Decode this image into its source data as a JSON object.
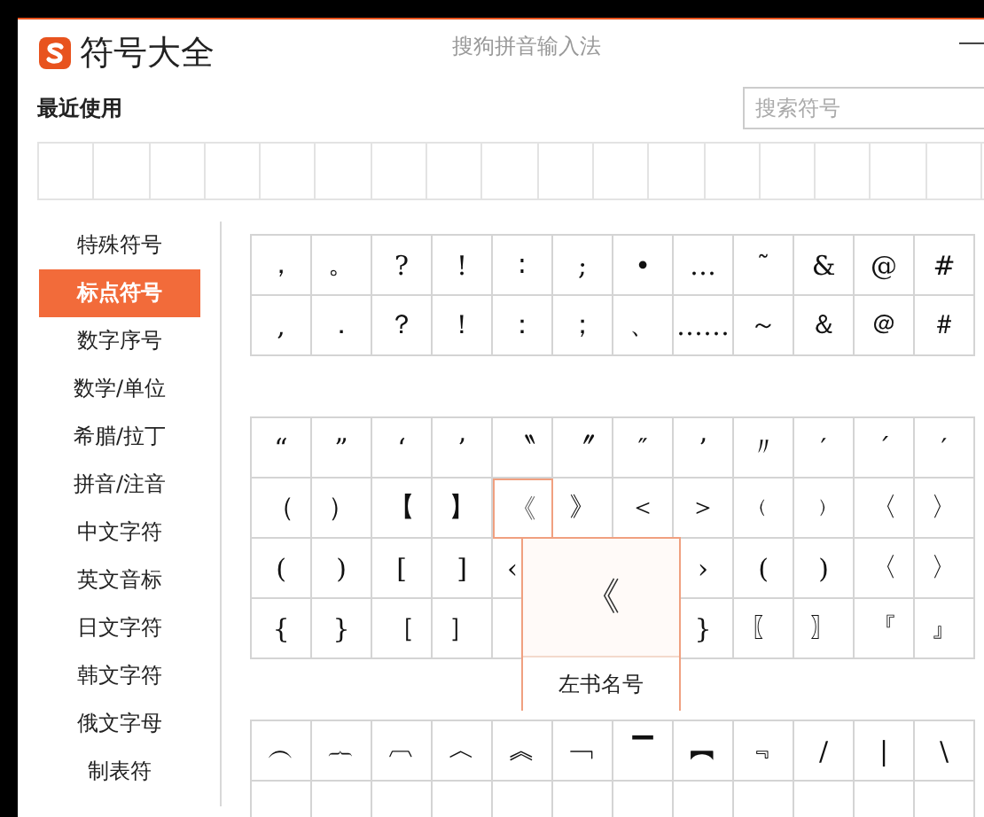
{
  "window": {
    "title": "符号大全",
    "app_name": "搜狗拼音输入法",
    "minimize": "—"
  },
  "recent": {
    "label": "最近使用"
  },
  "search": {
    "placeholder": "搜索符号"
  },
  "sidebar": {
    "items": [
      {
        "label": "特殊符号",
        "selected": false
      },
      {
        "label": "标点符号",
        "selected": true
      },
      {
        "label": "数字序号",
        "selected": false
      },
      {
        "label": "数学/单位",
        "selected": false
      },
      {
        "label": "希腊/拉丁",
        "selected": false
      },
      {
        "label": "拼音/注音",
        "selected": false
      },
      {
        "label": "中文字符",
        "selected": false
      },
      {
        "label": "英文音标",
        "selected": false
      },
      {
        "label": "日文字符",
        "selected": false
      },
      {
        "label": "韩文字符",
        "selected": false
      },
      {
        "label": "俄文字母",
        "selected": false
      },
      {
        "label": "制表符",
        "selected": false
      }
    ]
  },
  "symbol_groups": [
    {
      "rows": [
        [
          {
            "symbol": "，",
            "hovered": false
          },
          {
            "symbol": "。",
            "hovered": false
          },
          {
            "symbol": "?",
            "hovered": false
          },
          {
            "symbol": "!",
            "hovered": false
          },
          {
            "symbol": "∶",
            "hovered": false
          },
          {
            "symbol": ";",
            "hovered": false
          },
          {
            "symbol": "•",
            "hovered": false
          },
          {
            "symbol": "…",
            "hovered": false
          },
          {
            "symbol": "˜",
            "hovered": false
          },
          {
            "symbol": "&",
            "hovered": false
          },
          {
            "symbol": "@",
            "hovered": false
          },
          {
            "symbol": "#",
            "hovered": false
          }
        ],
        [
          {
            "symbol": ",",
            "hovered": false
          },
          {
            "symbol": "．",
            "hovered": false
          },
          {
            "symbol": "？",
            "hovered": false
          },
          {
            "symbol": "！",
            "hovered": false
          },
          {
            "symbol": "：",
            "hovered": false
          },
          {
            "symbol": "；",
            "hovered": false
          },
          {
            "symbol": "、",
            "hovered": false
          },
          {
            "symbol": "……",
            "hovered": false
          },
          {
            "symbol": "～",
            "hovered": false
          },
          {
            "symbol": "＆",
            "hovered": false
          },
          {
            "symbol": "＠",
            "hovered": false
          },
          {
            "symbol": "＃",
            "hovered": false
          }
        ]
      ]
    },
    {
      "rows": [
        [
          {
            "symbol": "“",
            "hovered": false
          },
          {
            "symbol": "”",
            "hovered": false
          },
          {
            "symbol": "‘",
            "hovered": false
          },
          {
            "symbol": "’",
            "hovered": false
          },
          {
            "symbol": "〝",
            "hovered": false
          },
          {
            "symbol": "〞",
            "hovered": false
          },
          {
            "symbol": "″",
            "hovered": false
          },
          {
            "symbol": "’",
            "hovered": false
          },
          {
            "symbol": "〃",
            "hovered": false
          },
          {
            "symbol": "′",
            "hovered": false
          },
          {
            "symbol": "´",
            "hovered": false
          },
          {
            "symbol": "′",
            "hovered": false
          }
        ],
        [
          {
            "symbol": "（",
            "hovered": false
          },
          {
            "symbol": "）",
            "hovered": false
          },
          {
            "symbol": "【",
            "hovered": false
          },
          {
            "symbol": "】",
            "hovered": false
          },
          {
            "symbol": "《",
            "hovered": true
          },
          {
            "symbol": "》",
            "hovered": false
          },
          {
            "symbol": "＜",
            "hovered": false
          },
          {
            "symbol": "＞",
            "hovered": false
          },
          {
            "symbol": "﹙",
            "hovered": false
          },
          {
            "symbol": "﹚",
            "hovered": false
          },
          {
            "symbol": "〈",
            "hovered": false
          },
          {
            "symbol": "〉",
            "hovered": false
          }
        ],
        [
          {
            "symbol": "(",
            "hovered": false
          },
          {
            "symbol": ")",
            "hovered": false
          },
          {
            "symbol": "[",
            "hovered": false
          },
          {
            "symbol": "]",
            "hovered": false
          },
          {
            "symbol": "‹",
            "hovered": false
          },
          null,
          null,
          {
            "symbol": "›",
            "hovered": false
          },
          {
            "symbol": "(",
            "hovered": false
          },
          {
            "symbol": ")",
            "hovered": false
          },
          {
            "symbol": "〈",
            "hovered": false
          },
          {
            "symbol": "〉",
            "hovered": false
          }
        ],
        [
          {
            "symbol": "{",
            "hovered": false
          },
          {
            "symbol": "}",
            "hovered": false
          },
          {
            "symbol": "［",
            "hovered": false
          },
          {
            "symbol": "］",
            "hovered": false
          },
          null,
          null,
          null,
          {
            "symbol": "}",
            "hovered": false
          },
          {
            "symbol": "〖",
            "hovered": false
          },
          {
            "symbol": "〗",
            "hovered": false
          },
          {
            "symbol": "『",
            "hovered": false
          },
          {
            "symbol": "』",
            "hovered": false
          }
        ]
      ]
    },
    {
      "rows": [
        [
          {
            "symbol": "︵",
            "hovered": false
          },
          {
            "symbol": "︷",
            "hovered": false
          },
          {
            "symbol": "︹",
            "hovered": false
          },
          {
            "symbol": "︿",
            "hovered": false
          },
          {
            "symbol": "︽",
            "hovered": false
          },
          {
            "symbol": "﹁",
            "hovered": false
          },
          {
            "symbol": "▔",
            "hovered": false
          },
          {
            "symbol": "︻",
            "hovered": false
          },
          {
            "symbol": "﹃",
            "hovered": false
          },
          {
            "symbol": "/",
            "hovered": false
          },
          {
            "symbol": "|",
            "hovered": false
          },
          {
            "symbol": "\\",
            "hovered": false
          }
        ],
        [
          null,
          null,
          null,
          null,
          null,
          null,
          null,
          null,
          null,
          null,
          null,
          null
        ]
      ]
    }
  ],
  "tooltip": {
    "symbol": "《",
    "name": "左书名号"
  }
}
